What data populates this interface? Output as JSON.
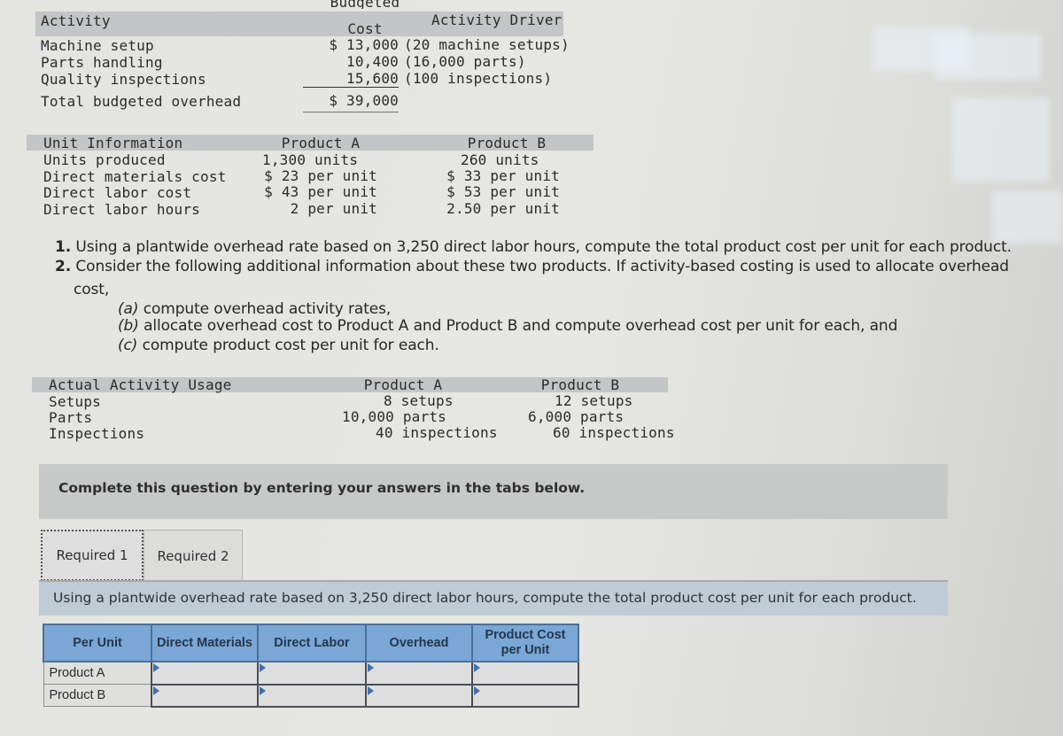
{
  "budget_table": {
    "headers": {
      "activity": "Activity",
      "cost_top": "Budgeted",
      "cost": "Cost",
      "driver": "Activity Driver"
    },
    "rows": [
      {
        "activity": "Machine setup",
        "cost": "$ 13,000",
        "driver": "(20 machine setups)"
      },
      {
        "activity": "Parts handling",
        "cost": "10,400",
        "driver": "(16,000 parts)"
      },
      {
        "activity": "Quality inspections",
        "cost": "15,600",
        "driver": "(100 inspections)"
      }
    ],
    "total": {
      "label": "Total budgeted overhead",
      "value": "$ 39,000"
    }
  },
  "unit_table": {
    "headers": {
      "label": "Unit Information",
      "a": "Product A",
      "b": "Product B"
    },
    "rows": [
      {
        "label": "Units produced",
        "a": "1,300 units",
        "b": "260 units"
      },
      {
        "label": "Direct materials cost",
        "a": "$ 23 per unit",
        "b": "$ 33 per unit"
      },
      {
        "label": "Direct labor cost",
        "a": "$ 43 per unit",
        "b": "$ 53 per unit"
      },
      {
        "label": "Direct labor hours",
        "a": "2 per unit",
        "b": "2.50 per unit"
      }
    ]
  },
  "questions": {
    "q1_num": "1.",
    "q1": "Using a plantwide overhead rate based on 3,250 direct labor hours, compute the total product cost per unit for each product.",
    "q2_num": "2.",
    "q2a": "Consider the following additional information about these two products. If activity-based costing is used to allocate overhead",
    "q2b": "cost,",
    "sub": [
      {
        "tag": "(a)",
        "text": " compute overhead activity rates,"
      },
      {
        "tag": "(b)",
        "text": " allocate overhead cost to Product A and Product B and compute overhead cost per unit for each, and"
      },
      {
        "tag": "(c)",
        "text": " compute product cost per unit for each."
      }
    ]
  },
  "usage_table": {
    "headers": {
      "label": "Actual Activity Usage",
      "a": "Product A",
      "b": "Product B"
    },
    "rows": [
      {
        "label": "Setups",
        "a": "8 setups",
        "b": "12 setups"
      },
      {
        "label": "Parts",
        "a": "10,000 parts",
        "b": "6,000 parts"
      },
      {
        "label": "Inspections",
        "a": "40 inspections",
        "b": "60 inspections"
      }
    ]
  },
  "instructions": "Complete this question by entering your answers in the tabs below.",
  "tabs": [
    {
      "label": "Required 1",
      "active": true
    },
    {
      "label": "Required 2",
      "active": false
    }
  ],
  "required_prompt": "Using a plantwide overhead rate based on 3,250 direct labor hours, compute the total product cost per unit for each product.",
  "answer_table": {
    "headers": [
      "Per Unit",
      "Direct Materials",
      "Direct Labor",
      "Overhead",
      "Product Cost per Unit"
    ],
    "rows": [
      {
        "label": "Product A",
        "values": [
          "",
          "",
          "",
          ""
        ]
      },
      {
        "label": "Product B",
        "values": [
          "",
          "",
          "",
          ""
        ]
      }
    ]
  }
}
